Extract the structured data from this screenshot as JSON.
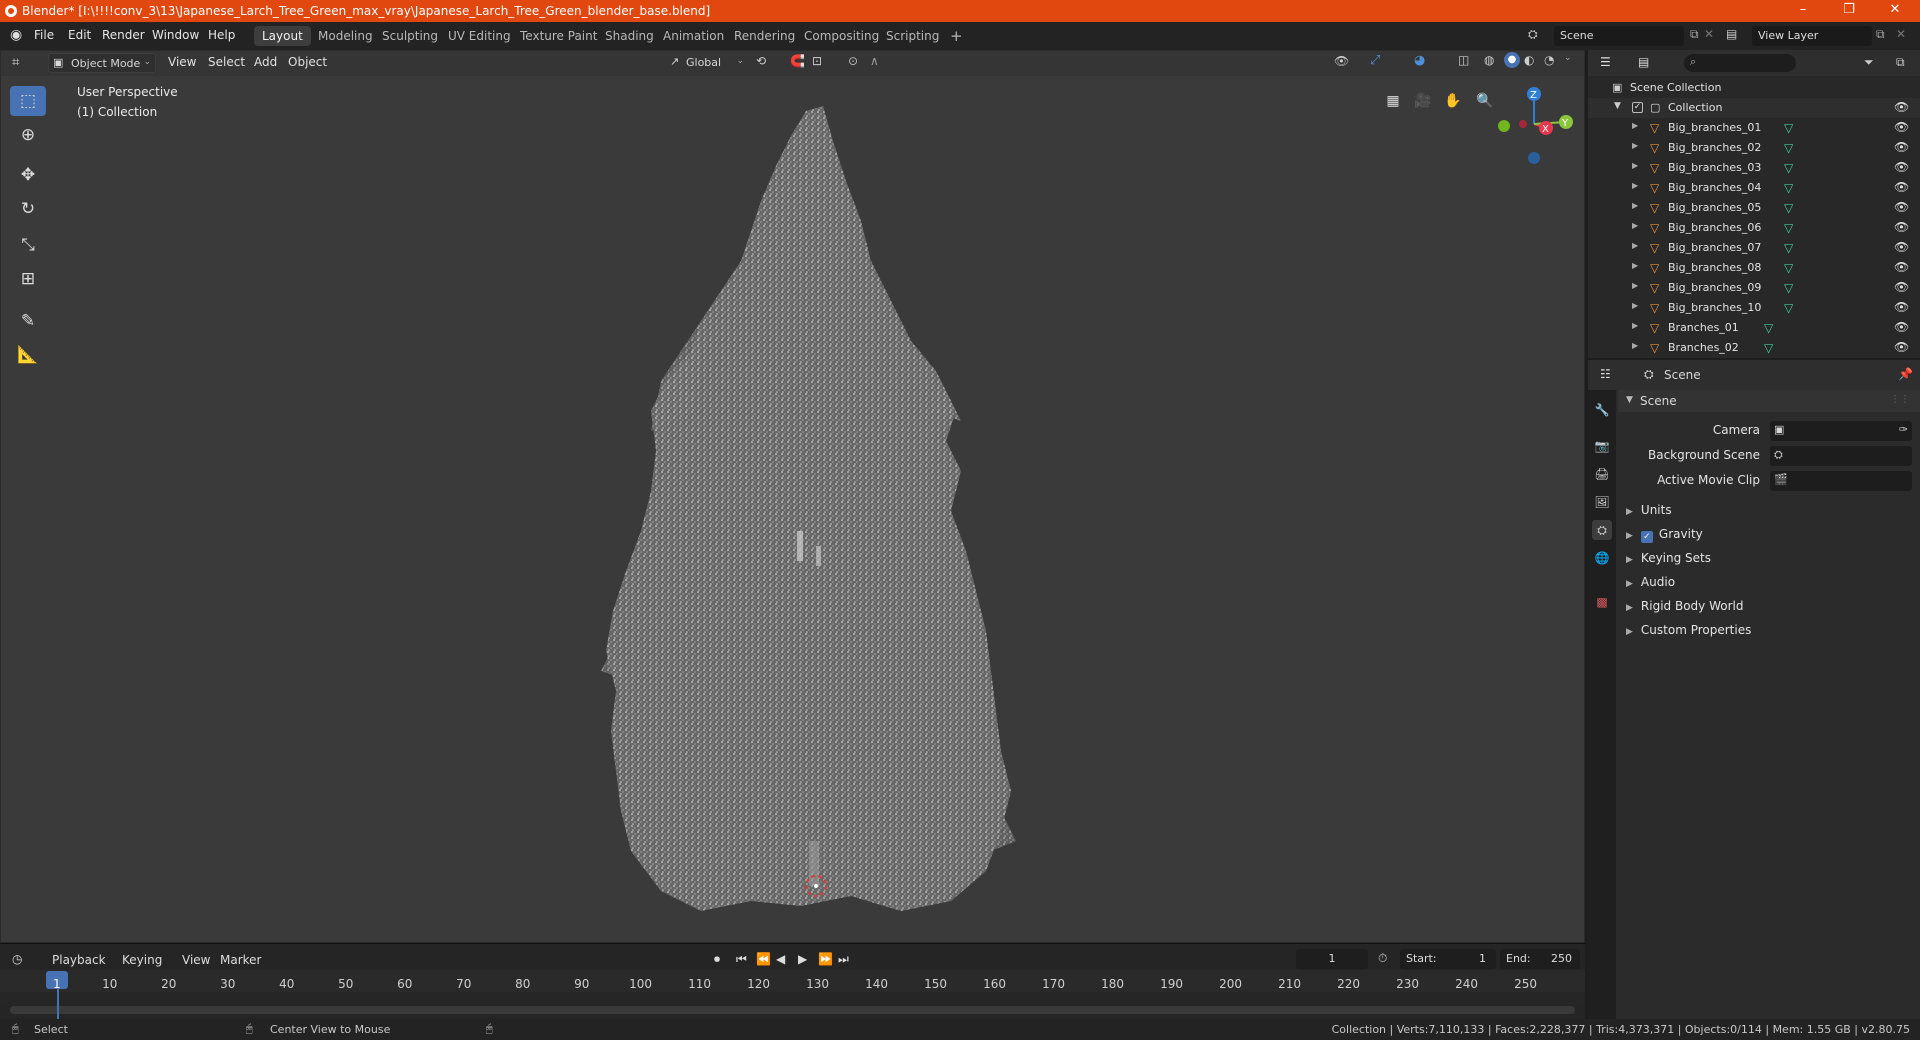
{
  "window": {
    "title": "Blender* [I:\\!!!!conv_3\\13\\Japanese_Larch_Tree_Green_max_vray\\Japanese_Larch_Tree_Green_blender_base.blend]",
    "minimize": "–",
    "maximize": "❐",
    "close": "✕"
  },
  "menus": [
    "File",
    "Edit",
    "Render",
    "Window",
    "Help"
  ],
  "workspaces": [
    "Layout",
    "Modeling",
    "Sculpting",
    "UV Editing",
    "Texture Paint",
    "Shading",
    "Animation",
    "Rendering",
    "Compositing",
    "Scripting"
  ],
  "active_workspace": "Layout",
  "add_workspace": "+",
  "scene_field": "Scene",
  "view_layer_field": "View Layer",
  "viewport": {
    "mode": "Object Mode",
    "menus": [
      "View",
      "Select",
      "Add",
      "Object"
    ],
    "orientation": "Global",
    "perspective_label": "User Perspective",
    "collection_label": "(1) Collection",
    "gizmo": {
      "z": "Z",
      "x": "X",
      "y": "Y"
    }
  },
  "tools": [
    "select-box",
    "cursor",
    "move",
    "rotate",
    "scale",
    "transform",
    "annotate",
    "measure"
  ],
  "timeline": {
    "menus": [
      "Playback",
      "Keying",
      "View",
      "Marker"
    ],
    "current_frame": "1",
    "start_label": "Start:",
    "start": "1",
    "end_label": "End:",
    "end": "250",
    "ticks": [
      "1",
      "10",
      "20",
      "30",
      "40",
      "50",
      "60",
      "70",
      "80",
      "90",
      "100",
      "110",
      "120",
      "130",
      "140",
      "150",
      "160",
      "170",
      "180",
      "190",
      "200",
      "210",
      "220",
      "230",
      "240",
      "250"
    ]
  },
  "status": {
    "left_hint": "Select",
    "mid_hint": "Center View to Mouse",
    "stats": "Collection | Verts:7,110,133 | Faces:2,228,377 | Tris:4,373,371 | Objects:0/114 | Mem: 1.55 GB | v2.80.75"
  },
  "outliner": {
    "root": "Scene Collection",
    "collection": "Collection",
    "items": [
      "Big_branches_01",
      "Big_branches_02",
      "Big_branches_03",
      "Big_branches_04",
      "Big_branches_05",
      "Big_branches_06",
      "Big_branches_07",
      "Big_branches_08",
      "Big_branches_09",
      "Big_branches_10",
      "Branches_01",
      "Branches_02"
    ]
  },
  "properties": {
    "header": "Scene",
    "section": "Scene",
    "camera_label": "Camera",
    "background_scene_label": "Background Scene",
    "active_movie_clip_label": "Active Movie Clip",
    "panels": [
      "Units",
      "Gravity",
      "Keying Sets",
      "Audio",
      "Rigid Body World",
      "Custom Properties"
    ],
    "gravity_checked": true
  },
  "colors": {
    "title_bar": "#e0480f",
    "active_blue": "#4772b3",
    "viewport_bg": "#3a3a3a",
    "mesh_orange": "#e5943f",
    "axis_x": "#e8384f",
    "axis_y": "#8cc63f",
    "axis_z": "#2f7fd6"
  }
}
